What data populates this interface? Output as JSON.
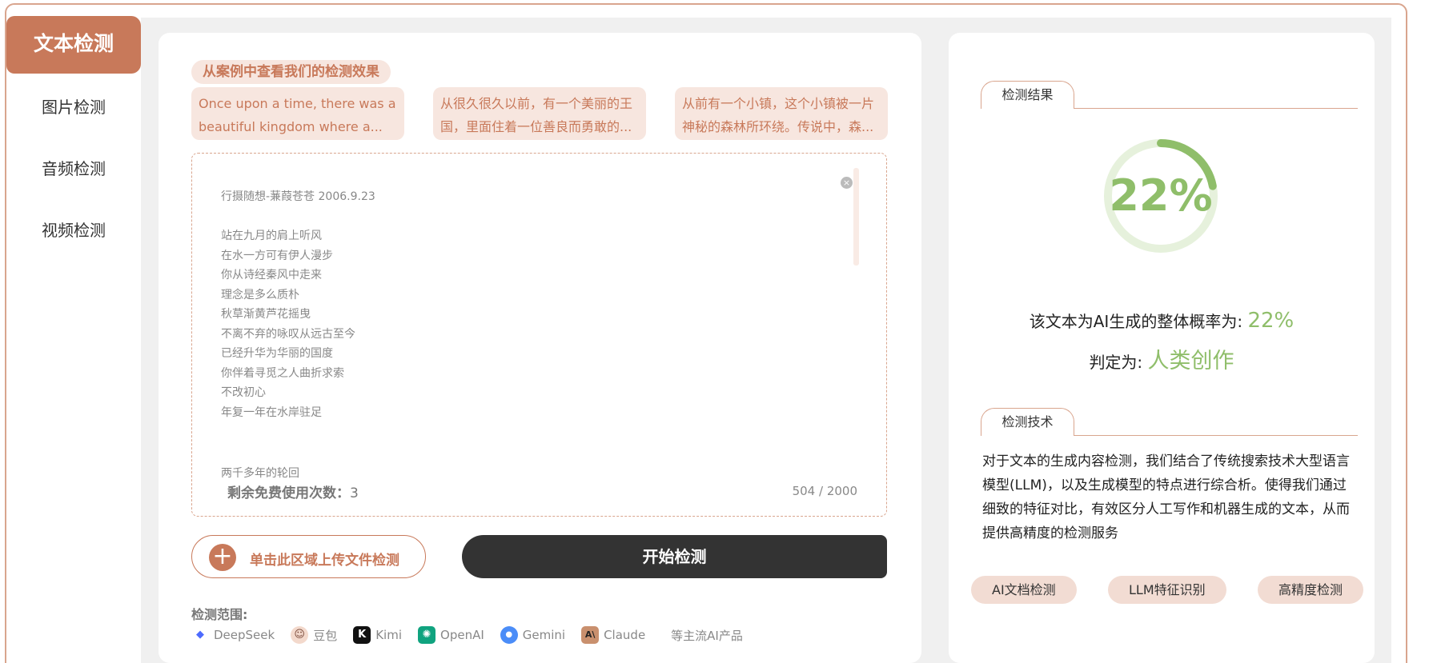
{
  "sidebar": {
    "items": [
      {
        "label": "文本检测",
        "active": true
      },
      {
        "label": "图片检测"
      },
      {
        "label": "音频检测"
      },
      {
        "label": "视频检测"
      }
    ]
  },
  "cases": {
    "title": "从案例中查看我们的检测效果",
    "items": [
      {
        "text": "Once upon a time, there was a beautiful kingdom where a..."
      },
      {
        "text": "从很久很久以前，有一个美丽的王国，里面住着一位善良而勇敢的..."
      },
      {
        "text": "从前有一个小镇，这个小镇被一片神秘的森林所环绕。传说中，森..."
      }
    ]
  },
  "editor": {
    "content": "行摄随想-蒹葭苍苍 2006.9.23\n\n站在九月的肩上听风\n在水一方可有伊人漫步\n你从诗经秦风中走来\n理念是多么质朴\n秋草渐黄芦花摇曳\n不离不弃的咏叹从远古至今\n已经升华为华丽的国度\n你伴着寻觅之人曲折求索\n不改初心\n年复一年在水岸驻足",
    "last_line": "两千多年的轮回",
    "remaining_label": "剩余免费使用次数：",
    "remaining_count": "3",
    "char_count": "504 / 2000",
    "clear_icon": "×"
  },
  "actions": {
    "upload_label": "单击此区域上传文件检测",
    "upload_icon": "+",
    "start_label": "开始检测"
  },
  "scope": {
    "label": "检测范围:",
    "models": [
      {
        "name": "DeepSeek",
        "icon": "deepseek-icon",
        "color": "#4d6bfe",
        "glyph": "◆"
      },
      {
        "name": "豆包",
        "icon": "doubao-icon",
        "color": "#e9b9a8",
        "glyph": "☺"
      },
      {
        "name": "Kimi",
        "icon": "kimi-icon",
        "color": "#111111",
        "glyph": "K"
      },
      {
        "name": "OpenAI",
        "icon": "openai-icon",
        "color": "#10a37f",
        "glyph": "✺"
      },
      {
        "name": "Gemini",
        "icon": "gemini-icon",
        "color": "#4b8df8",
        "glyph": "●"
      },
      {
        "name": "Claude",
        "icon": "claude-icon",
        "color": "#c9906e",
        "glyph": "A\\"
      }
    ],
    "more": "等主流AI产品"
  },
  "result": {
    "section_title": "检测结果",
    "percent": 22,
    "percent_label": "22%",
    "prob_label": "该文本为AI生成的整体概率为:",
    "prob_value": "22%",
    "verdict_label": "判定为:",
    "verdict_value": "人类创作",
    "accent_color": "#8fbe6a"
  },
  "technique": {
    "section_title": "检测技术",
    "description": "对于文本的生成内容检测，我们结合了传统搜索技术大型语言模型(LLM)，以及生成模型的特点进行综合析。使得我们通过细致的特征对比，有效区分人工写作和机器生成的文本，从而提供高精度的检测服务",
    "tags": [
      "AI文档检测",
      "LLM特征识别",
      "高精度检测"
    ]
  },
  "colors": {
    "brand": "#c8795a",
    "brand_light": "#f7e6df",
    "dark_button": "#333333"
  }
}
